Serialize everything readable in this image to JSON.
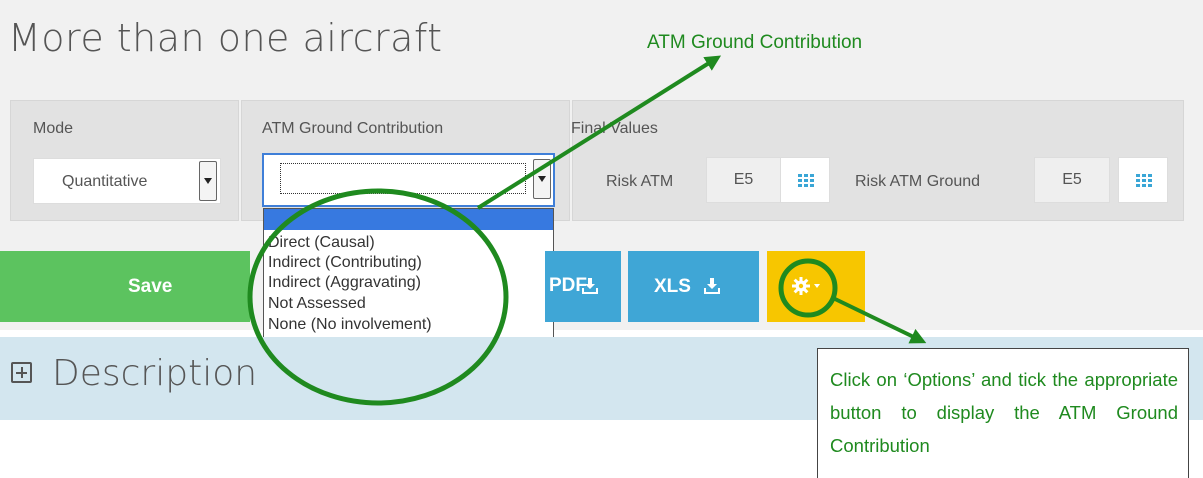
{
  "page": {
    "title": "More than one aircraft"
  },
  "filters": {
    "mode": {
      "label": "Mode",
      "value": "Quantitative"
    },
    "atm_ground": {
      "label": "ATM Ground Contribution",
      "value": "",
      "options": [
        "",
        "Direct (Causal)",
        "Indirect (Contributing)",
        "Indirect (Aggravating)",
        "Not Assessed",
        "None (No involvement)"
      ]
    },
    "final_values": {
      "label": "Final Values",
      "risk_atm": {
        "label": "Risk ATM",
        "value": "E5"
      },
      "risk_atm_ground": {
        "label": "Risk ATM Ground",
        "value": "E5"
      }
    }
  },
  "toolbar": {
    "save_label": "Save",
    "pdf_label": "PDF",
    "xls_label": "XLS"
  },
  "section": {
    "description_label": "Description"
  },
  "annotations": {
    "top_label": "ATM Ground Contribution",
    "callout": "Click on ‘Options’ and tick the appropriate button to display the ATM Ground Contribution",
    "color": "#1f8a1f"
  },
  "icons": [
    "download-icon",
    "grid-icon",
    "gear-icon",
    "caret-down-icon",
    "plus-box-icon"
  ],
  "colors": {
    "save": "#5cc35f",
    "export": "#3fa6d6",
    "options": "#f7c600",
    "selected": "#3779e0"
  }
}
